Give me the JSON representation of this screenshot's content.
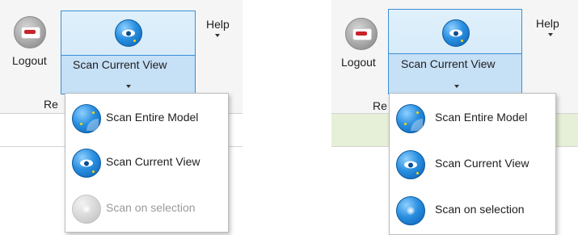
{
  "panels": [
    {
      "ribbon": {
        "logout_label": "Logout",
        "scan_button_label": "Scan Current View",
        "help_label": "Help",
        "group_label_partial": "Re"
      },
      "strip_color": "#ffffff",
      "menu": {
        "items": [
          {
            "label": "Scan Entire Model",
            "icon": "globe-radar-icon",
            "enabled": true
          },
          {
            "label": "Scan Current View",
            "icon": "globe-eye-icon",
            "enabled": true
          },
          {
            "label": "Scan on selection",
            "icon": "globe-sparkle-icon",
            "enabled": false
          }
        ]
      }
    },
    {
      "ribbon": {
        "logout_label": "Logout",
        "scan_button_label": "Scan Current View",
        "help_label": "Help",
        "group_label_partial": "Re"
      },
      "strip_color": "#e6f0d8",
      "menu": {
        "items": [
          {
            "label": "Scan Entire Model",
            "icon": "globe-radar-icon",
            "enabled": true
          },
          {
            "label": "Scan Current View",
            "icon": "globe-eye-icon",
            "enabled": true
          },
          {
            "label": "Scan on selection",
            "icon": "globe-sparkle-icon",
            "enabled": true
          }
        ]
      }
    }
  ],
  "colors": {
    "accent": "#3d8fd4",
    "ribbon_bg": "#f5f5f5",
    "disabled_text": "#9a9a9a"
  }
}
